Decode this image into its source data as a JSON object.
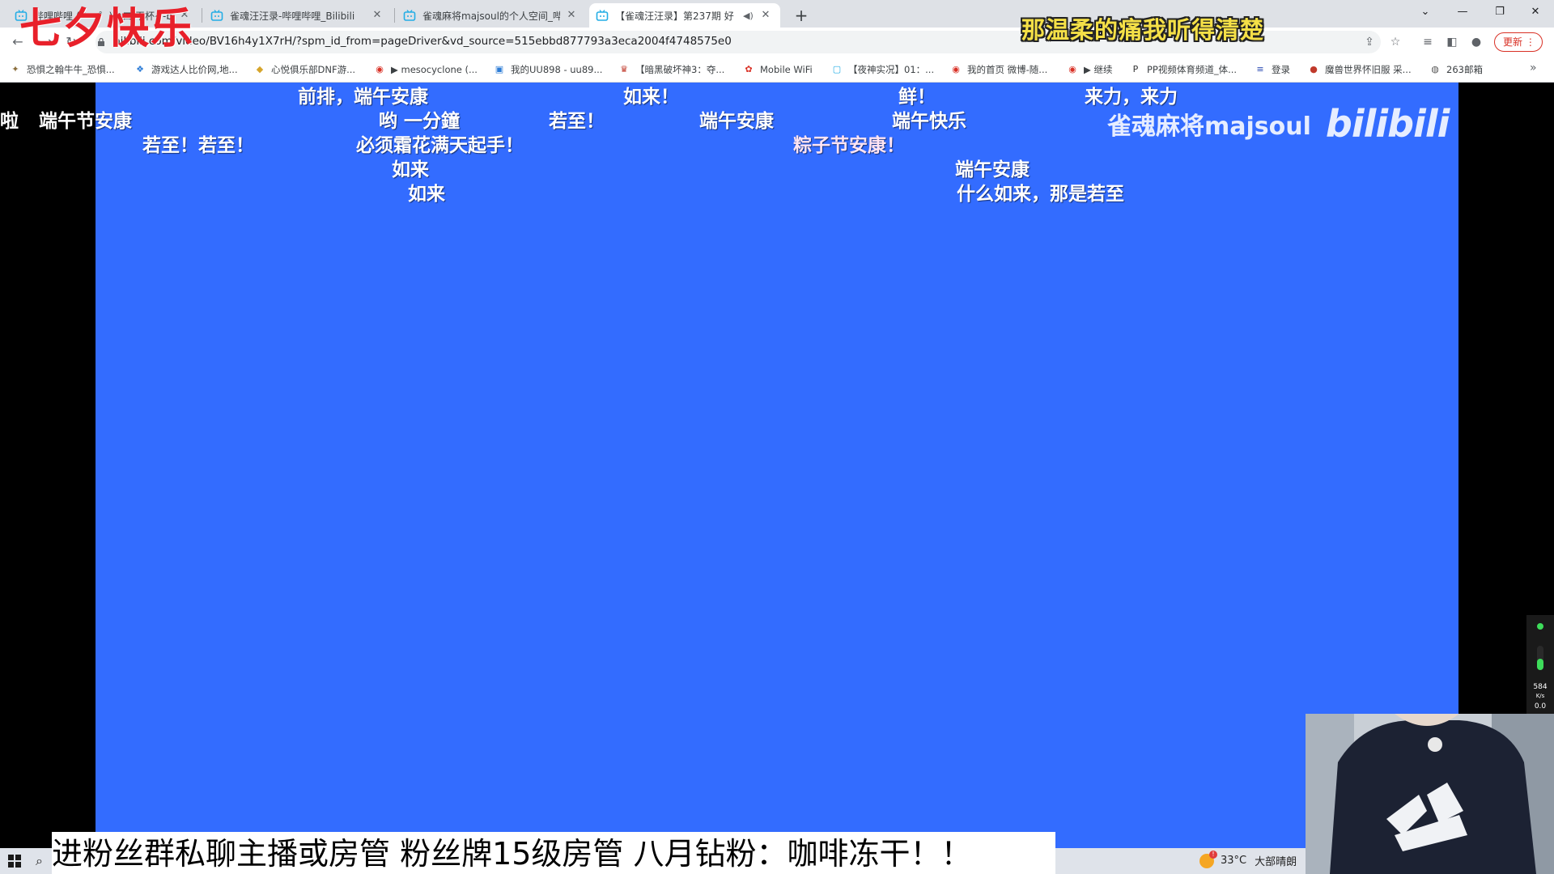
{
  "tabs": [
    {
      "title": "哔哩哔哩 ( ゜- ゜)つロ 干杯~-bili"
    },
    {
      "title": "雀魂汪汪录-哔哩哔哩_Bilibili"
    },
    {
      "title": "雀魂麻将majsoul的个人空间_哔"
    },
    {
      "title": "【雀魂汪汪录】第237期 好"
    }
  ],
  "toolbar": {
    "url": "bilibili.com/video/BV16h4y1X7rH/?spm_id_from=pageDriver&vd_source=515ebbd877793a3eca2004f4748575e0",
    "update_label": "更新"
  },
  "bookmarks": [
    {
      "label": "恐惧之翰牛牛_恐惧..."
    },
    {
      "label": "游戏达人比价网,地..."
    },
    {
      "label": "心悦俱乐部DNF游..."
    },
    {
      "label": "▶ mesocyclone (..."
    },
    {
      "label": "我的UU898 - uu89..."
    },
    {
      "label": "【暗黑破坏神3：夺..."
    },
    {
      "label": "Mobile WiFi"
    },
    {
      "label": "【夜神实况】01：..."
    },
    {
      "label": "我的首页 微博-随..."
    },
    {
      "label": "▶ 继续"
    },
    {
      "label": "PP视频体育频道_体..."
    },
    {
      "label": "登录"
    },
    {
      "label": "魔兽世界怀旧服 采..."
    },
    {
      "label": "263邮箱"
    }
  ],
  "overlay": {
    "top_left": "七夕快乐",
    "top_right": "那温柔的痛我听得清楚"
  },
  "video": {
    "danmaku": [
      "前排，端午安康",
      "如来！",
      "鲜！",
      "来力，来力",
      "啦",
      "端午节安康",
      "哟 一分鐘",
      "若至！",
      "端午安康",
      "端午快乐",
      "若至！若至！",
      "必须霜花满天起手！",
      "粽子节安康！",
      "如来",
      "端午安康",
      "如来",
      "什么如来，那是若至"
    ],
    "watermark_text": "雀魂麻将majsoul",
    "watermark_logo": "bilibili"
  },
  "ticker": {
    "text": "进粉丝群私聊主播或房管 粉丝牌15级房管 八月钻粉：咖啡冻干！！"
  },
  "taskbar": {
    "temperature": "33°C",
    "weather": "大部晴朗"
  },
  "netwidget": {
    "speed": "584",
    "unit": "K/s",
    "lower": "0.0"
  },
  "colors": {
    "video_bg": "#336cff",
    "overlay_red": "#e8202a",
    "overlay_yellow": "#f5e047"
  }
}
